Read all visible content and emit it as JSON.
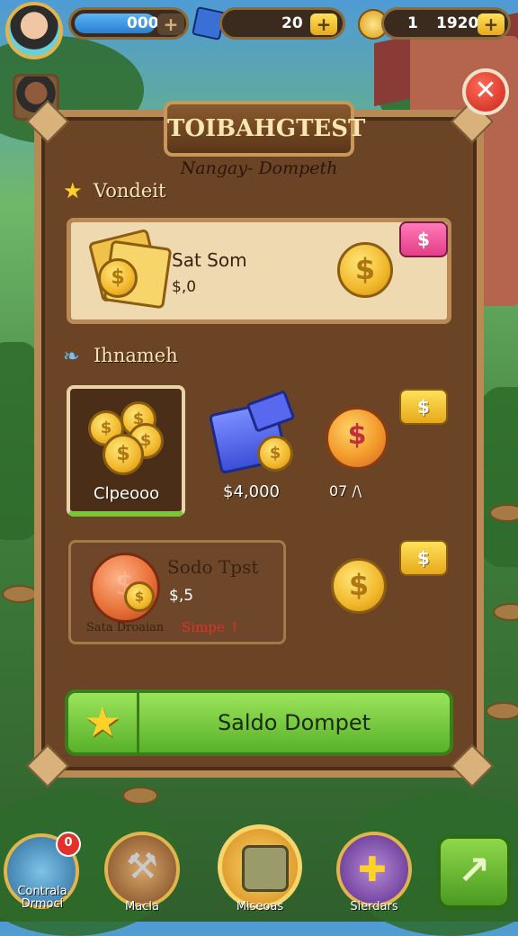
{
  "topbar": {
    "energy_value": "000",
    "gems_value": "20",
    "gold_level": "1",
    "gold_value": "1920",
    "plus_label": "+"
  },
  "panel": {
    "title": "TOIBAHGTEST",
    "subtitle": "Nangay- Dompeth",
    "close_label": "✕"
  },
  "featured": {
    "section_label": "Vondeit",
    "item_title": "Sat Som",
    "item_price": "$,0",
    "tag": "$"
  },
  "offers": {
    "section_label": "Ihnameh",
    "items": [
      {
        "label": "Clpeooo",
        "tag": ""
      },
      {
        "label": "$4,000",
        "tag": ""
      },
      {
        "label": "07 /\\",
        "tag": "$"
      }
    ]
  },
  "bundle": {
    "title": "Sodo Tpst",
    "price": "$,5",
    "note_left": "Sata Droaian",
    "note_right": "Simpe ↑",
    "tag": "$"
  },
  "cta": {
    "label": "Saldo Dompet"
  },
  "bottom_nav": {
    "items": [
      {
        "label": "Contrala Drmoci",
        "badge": "0"
      },
      {
        "label": "Macla"
      },
      {
        "label": "Miseoas"
      },
      {
        "label": "Sierdars"
      }
    ]
  },
  "colors": {
    "panel": "#6b4426",
    "frame": "#b98a55",
    "cta_green": "#58b12a",
    "coin_gold": "#f1b72a"
  }
}
